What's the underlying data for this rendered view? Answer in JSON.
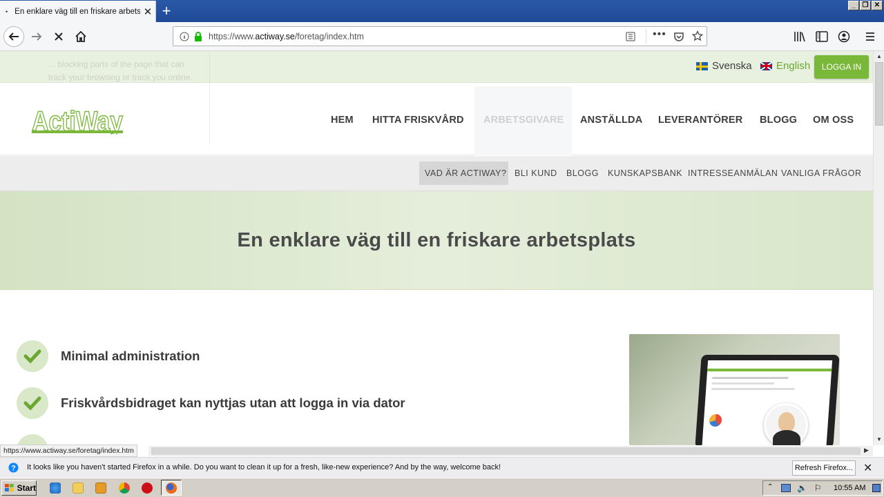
{
  "browser": {
    "tab_title": "En enklare väg till en friskare arbetsplats",
    "tab_dot": "•",
    "new_tab_symbol": "+",
    "url_prefix": "https://www.",
    "url_domain": "actiway.se",
    "url_path": "/foretag/index.htm",
    "status_url": "https://www.actiway.se/foretag/index.htm"
  },
  "site": {
    "languages": [
      {
        "label": "Svenska",
        "icon": "flag-se-icon"
      },
      {
        "label": "English",
        "icon": "flag-gb-icon"
      }
    ],
    "login_label": "LOGGA IN",
    "logo_text": "ActiWay",
    "main_nav": [
      "HEM",
      "HITTA FRISKVÅRD",
      "ARBETSGIVARE",
      "ANSTÄLLDA",
      "LEVERANTÖRER",
      "BLOGG",
      "OM OSS"
    ],
    "main_nav_active": "ARBETSGIVARE",
    "sub_nav": [
      "VAD ÄR ACTIWAY?",
      "BLI KUND",
      "BLOGG",
      "KUNSKAPSBANK",
      "INTRESSEANMÄLAN",
      "VANLIGA FRÅGOR"
    ],
    "sub_nav_active": "VAD ÄR ACTIWAY?",
    "hero_title": "En enklare väg till en friskare arbetsplats",
    "features": [
      "Minimal administration",
      "Friskvårdsbidraget kan nyttjas utan att logga in via dator"
    ],
    "ghost_text": "... blocking parts of the page that can track your browsing or track you online."
  },
  "notification": {
    "message": "It looks like you haven't started Firefox in a while. Do you want to clean it up for a fresh, like-new experience? And by the way, welcome back!",
    "button_label": "Refresh Firefox..."
  },
  "taskbar": {
    "start_label": "Start",
    "clock": "10:55 AM"
  },
  "colors": {
    "brand_green": "#7ab83a",
    "titlebar_blue": "#2b58a8"
  }
}
